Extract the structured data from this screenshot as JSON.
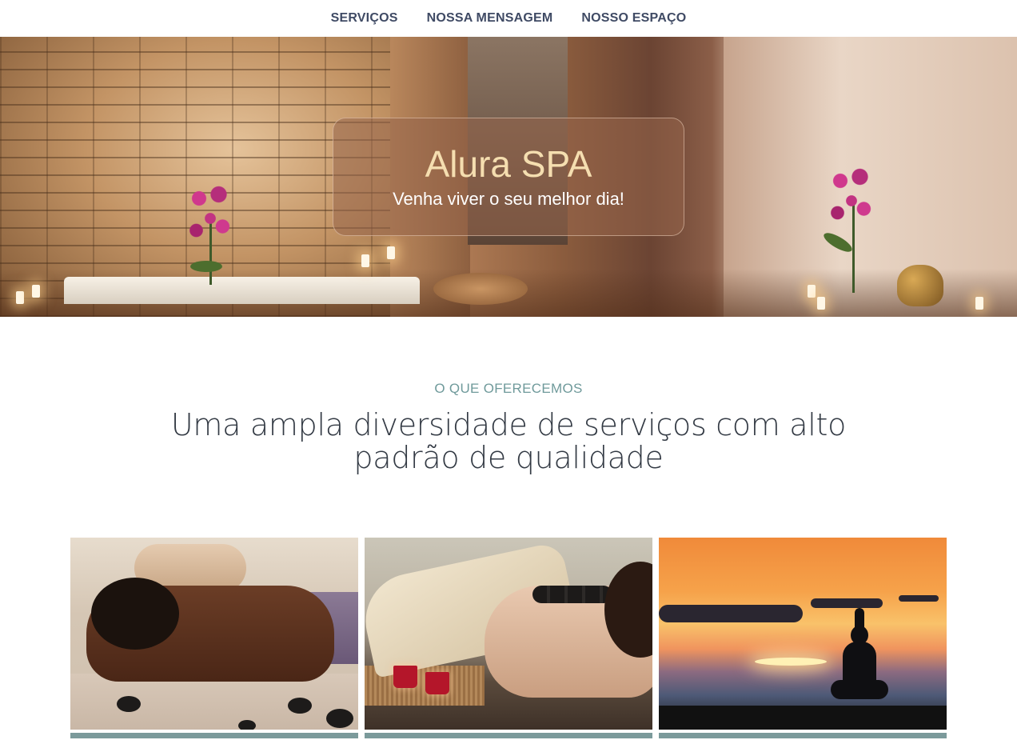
{
  "nav": {
    "items": [
      {
        "label": "SERVIÇOS"
      },
      {
        "label": "NOSSA MENSAGEM"
      },
      {
        "label": "NOSSO ESPAÇO"
      }
    ]
  },
  "hero": {
    "title": "Alura SPA",
    "subtitle": "Venha viver o seu melhor dia!"
  },
  "services": {
    "eyebrow": "O QUE OFERECEMOS",
    "headline": "Uma ampla diversidade de serviços com alto padrão de qualidade"
  },
  "colors": {
    "nav_text": "#3f4a64",
    "hero_title": "#f5deb0",
    "eyebrow": "#6f9a9b",
    "card_bar": "#7b9a9b"
  }
}
